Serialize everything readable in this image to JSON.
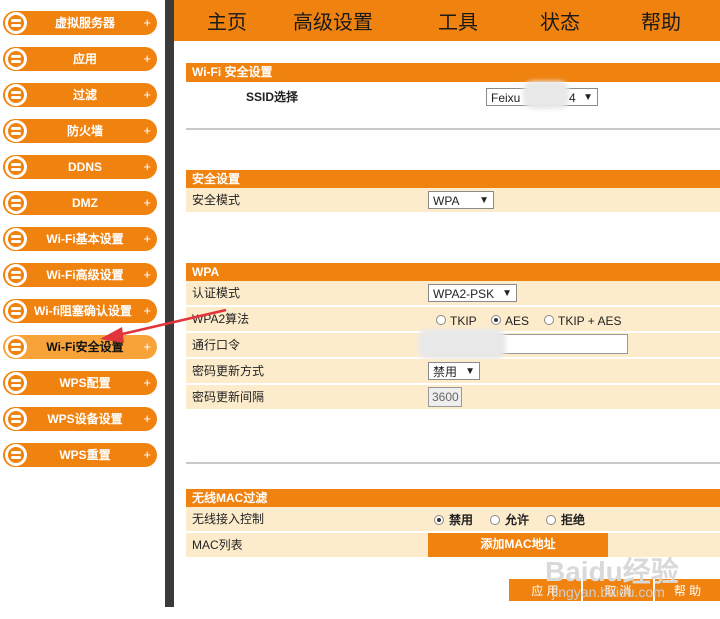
{
  "sidebar": {
    "items": [
      {
        "label": "虚拟服务器"
      },
      {
        "label": "应用"
      },
      {
        "label": "过滤"
      },
      {
        "label": "防火墙"
      },
      {
        "label": "DDNS"
      },
      {
        "label": "DMZ"
      },
      {
        "label": "Wi-Fi基本设置"
      },
      {
        "label": "Wi-Fi高级设置"
      },
      {
        "label": "Wi-fi阻塞确认设置"
      },
      {
        "label": "Wi-Fi安全设置"
      },
      {
        "label": "WPS配置"
      },
      {
        "label": "WPS设备设置"
      },
      {
        "label": "WPS重置"
      }
    ],
    "plus": "+",
    "active_index": 9
  },
  "topnav": {
    "items": [
      {
        "label": "主页"
      },
      {
        "label": "高级设置"
      },
      {
        "label": "工具"
      },
      {
        "label": "状态"
      },
      {
        "label": "帮助"
      }
    ]
  },
  "wifi_security": {
    "title": "Wi-Fi 安全设置",
    "ssid_label": "SSID选择",
    "ssid_value_prefix": "Feixu",
    "ssid_value_suffix": "4"
  },
  "security": {
    "title": "安全设置",
    "mode_label": "安全模式",
    "mode_value": "WPA"
  },
  "wpa": {
    "title": "WPA",
    "auth_label": "认证模式",
    "auth_value": "WPA2-PSK",
    "algo_label": "WPA2算法",
    "algo_options": [
      "TKIP",
      "AES",
      "TKIP + AES"
    ],
    "algo_selected": "AES",
    "passphrase_label": "通行口令",
    "renew_method_label": "密码更新方式",
    "renew_method_value": "禁用",
    "renew_interval_label": "密码更新间隔",
    "renew_interval_value": "3600"
  },
  "mac_filter": {
    "title": "无线MAC过滤",
    "access_label": "无线接入控制",
    "access_options": [
      "禁用",
      "允许",
      "拒绝"
    ],
    "access_selected": "禁用",
    "list_label": "MAC列表",
    "add_button": "添加MAC地址"
  },
  "footer": {
    "apply": "应 用",
    "cancel": "取 消",
    "help": "帮 助"
  },
  "watermark": {
    "brand": "Baidu经验",
    "url": "jingyan.baidu.com"
  },
  "colors": {
    "orange": "#f0820f",
    "row_bg": "#fdeccc",
    "arrow": "#e0343a"
  }
}
